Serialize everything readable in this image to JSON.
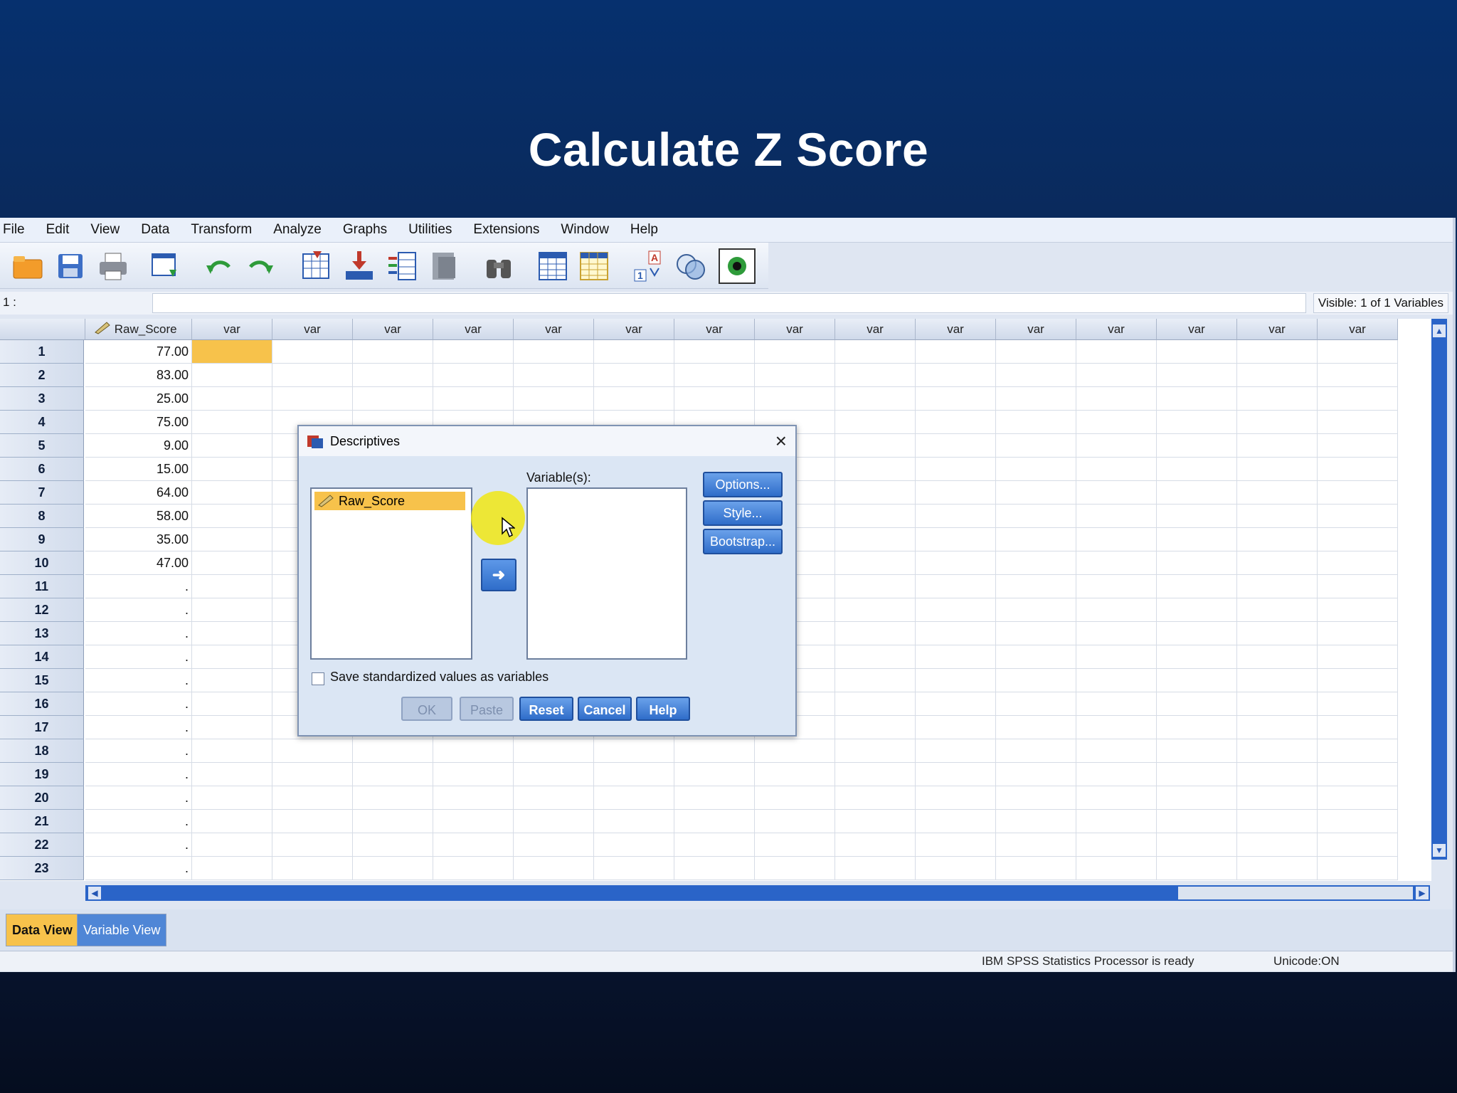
{
  "slide": {
    "title": "Calculate Z Score"
  },
  "menubar": {
    "items": [
      "File",
      "Edit",
      "View",
      "Data",
      "Transform",
      "Analyze",
      "Graphs",
      "Utilities",
      "Extensions",
      "Window",
      "Help"
    ]
  },
  "toolbar": {
    "icons": [
      "open-folder-icon",
      "save-icon",
      "print-icon",
      "recall-dialog-icon",
      "undo-icon",
      "redo-icon",
      "goto-case-icon",
      "goto-variable-icon",
      "variables-icon",
      "run-descriptive-icon",
      "find-icon",
      "insert-cases-icon",
      "insert-variable-icon",
      "split-file-icon",
      "weight-cases-icon",
      "select-cases-icon",
      "value-labels-icon",
      "use-variable-sets-icon"
    ]
  },
  "refbar": {
    "cell_ref": "1 :",
    "visible": "Visible: 1 of 1 Variables"
  },
  "grid": {
    "variable_name": "Raw_Score",
    "empty_column_label": "var",
    "empty_columns": 15,
    "rows": [
      {
        "n": "1",
        "value": "77.00"
      },
      {
        "n": "2",
        "value": "83.00"
      },
      {
        "n": "3",
        "value": "25.00"
      },
      {
        "n": "4",
        "value": "75.00"
      },
      {
        "n": "5",
        "value": "9.00"
      },
      {
        "n": "6",
        "value": "15.00"
      },
      {
        "n": "7",
        "value": "64.00"
      },
      {
        "n": "8",
        "value": "58.00"
      },
      {
        "n": "9",
        "value": "35.00"
      },
      {
        "n": "10",
        "value": "47.00"
      },
      {
        "n": "11",
        "value": "."
      },
      {
        "n": "12",
        "value": "."
      },
      {
        "n": "13",
        "value": "."
      },
      {
        "n": "14",
        "value": "."
      },
      {
        "n": "15",
        "value": "."
      },
      {
        "n": "16",
        "value": "."
      },
      {
        "n": "17",
        "value": "."
      },
      {
        "n": "18",
        "value": "."
      },
      {
        "n": "19",
        "value": "."
      },
      {
        "n": "20",
        "value": "."
      },
      {
        "n": "21",
        "value": "."
      },
      {
        "n": "22",
        "value": "."
      },
      {
        "n": "23",
        "value": "."
      }
    ]
  },
  "tabs": {
    "data_view": "Data View",
    "variable_view": "Variable View"
  },
  "status": {
    "processor": "IBM SPSS Statistics Processor is ready",
    "unicode": "Unicode:ON"
  },
  "dialog": {
    "title": "Descriptives",
    "source_item": "Raw_Score",
    "variables_label": "Variable(s):",
    "options": "Options...",
    "style": "Style...",
    "bootstrap": "Bootstrap...",
    "save_checkbox": "Save standardized values as variables",
    "save_checked": false,
    "ok": "OK",
    "paste": "Paste",
    "reset": "Reset",
    "cancel": "Cancel",
    "help": "Help"
  },
  "colors": {
    "accent": "#2f6dc9",
    "highlight": "#f7c24b",
    "slide_bg": "#0a2a5c"
  }
}
